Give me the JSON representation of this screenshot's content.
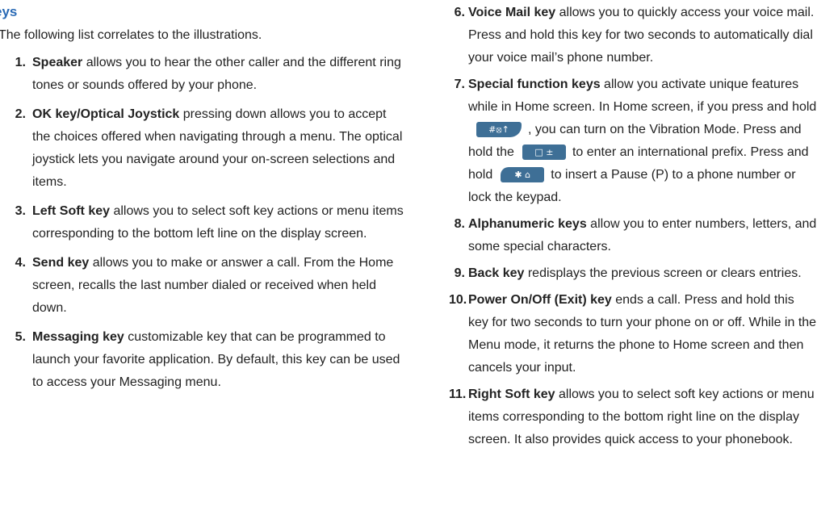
{
  "page": {
    "heading": "eys",
    "intro": "The following list correlates to the illustrations."
  },
  "left_items": [
    {
      "num": "1.",
      "term": "Speaker",
      "text": " allows you to hear the other caller and the different ring tones or sounds offered by your phone."
    },
    {
      "num": "2.",
      "term": "OK key/Optical Joystick",
      "text": " pressing down allows you to accept the choices offered when navigating through a menu. The optical joystick lets you navigate around your on-screen selections and items."
    },
    {
      "num": "3.",
      "term": "Left Soft key",
      "text": " allows you to select soft key actions or menu items corresponding to the bottom left line on the display screen."
    },
    {
      "num": "4.",
      "term": "Send key",
      "text": " allows you to make or answer a call. From the Home screen, recalls the last number dialed or received when held down."
    },
    {
      "num": "5.",
      "term": "Messaging key",
      "text": " customizable key that can be programmed to launch your favorite application. By default, this key can be used to access your Messaging menu."
    }
  ],
  "right_items": [
    {
      "num": "6.",
      "term": "Voice Mail key",
      "text": " allows you to quickly access your voice mail. Press and hold this key for two seconds to automatically dial your voice mail’s phone number."
    },
    {
      "num": "7.",
      "term": "Special function keys",
      "text_1": " allow you activate unique features while in Home screen. In Home screen, if you press and hold",
      "icon_vib": "vibration-key-icon",
      "text_2": ", you can turn on the Vibration Mode. Press and hold the",
      "icon_intl": "international-prefix-key-icon",
      "text_3": "to enter an international prefix. Press and hold",
      "icon_lock": "lock-pause-key-icon",
      "text_4": "to insert a Pause (P) to a phone number or lock the keypad."
    },
    {
      "num": "8.",
      "term": "Alphanumeric keys",
      "text": " allow you to enter numbers, letters, and some special characters."
    },
    {
      "num": "9.",
      "term": "Back key",
      "text": " redisplays the previous screen or clears entries."
    },
    {
      "num": "10.",
      "term": "Power On/Off (Exit) key",
      "text": " ends a call. Press and hold this key for two seconds to turn your phone on or off. While in the Menu mode, it returns the phone to Home screen and then cancels your input."
    },
    {
      "num": "11.",
      "term": "Right Soft key",
      "text": " allows you to select soft key actions or menu items corresponding to the bottom right line on the display screen. It also provides quick access to your phonebook."
    }
  ],
  "key_glyphs": {
    "vib": "#⦻↑",
    "intl": "□ ±",
    "lock": "✱ ⌂"
  },
  "colors": {
    "heading": "#2a6ab5",
    "key_icon": "#3e6f96"
  }
}
